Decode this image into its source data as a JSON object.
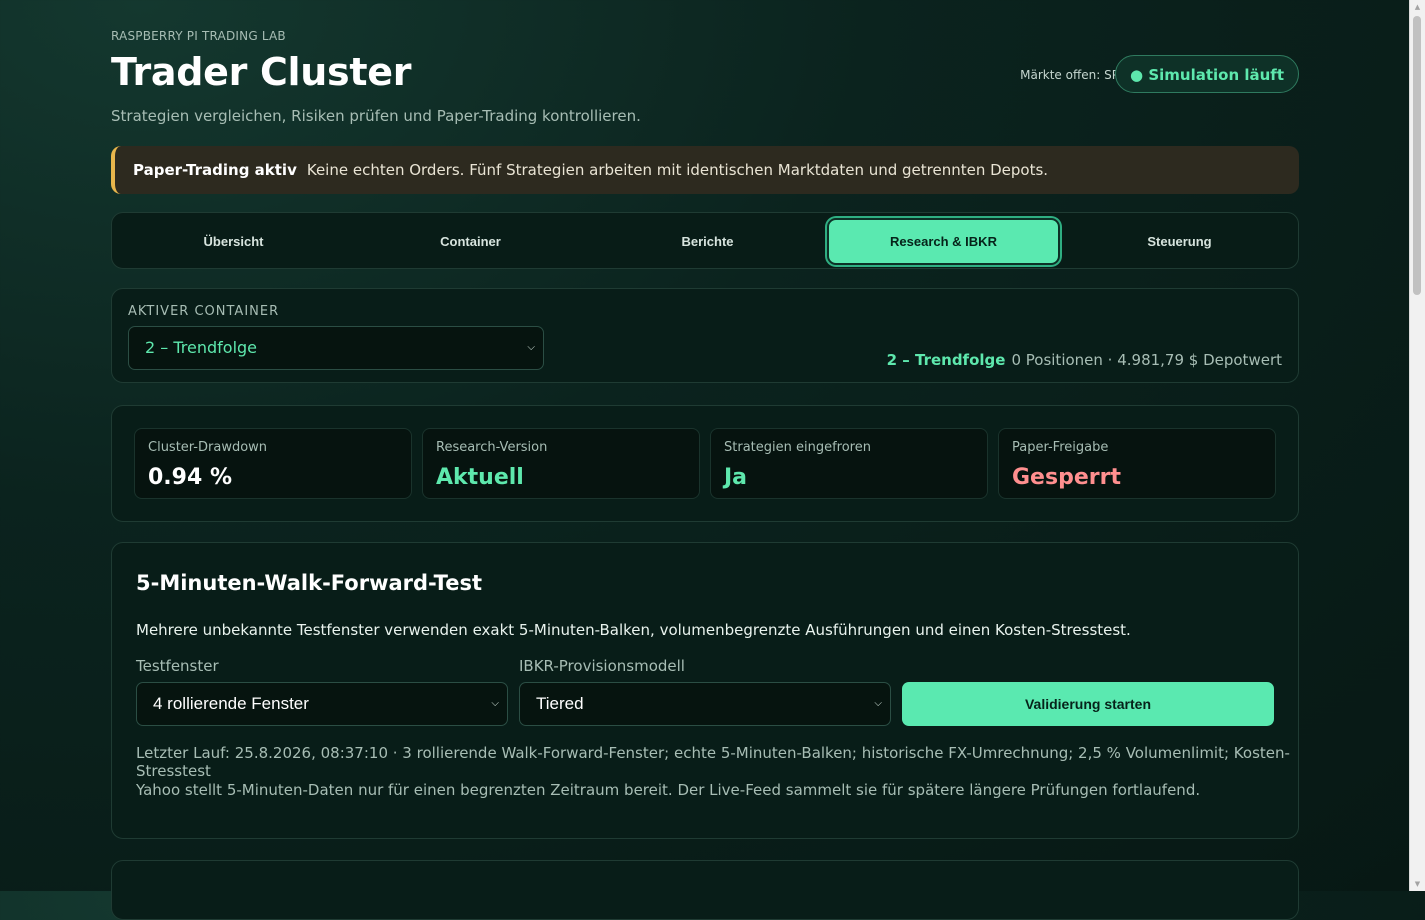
{
  "header": {
    "eyebrow": "RASPBERRY PI TRADING LAB",
    "title": "Trader Cluster",
    "subtitle": "Strategien vergleichen, Risiken prüfen und Paper-Trading kontrollieren.",
    "market_status": "Märkte offen: SPY",
    "simulation_badge": "● Simulation läuft"
  },
  "banner": {
    "label": "Paper-Trading aktiv",
    "text": "Keine echten Orders. Fünf Strategien arbeiten mit identischen Marktdaten und getrennten Depots."
  },
  "tabs": [
    {
      "label": "Übersicht",
      "active": false
    },
    {
      "label": "Container",
      "active": false
    },
    {
      "label": "Berichte",
      "active": false
    },
    {
      "label": "Research & IBKR",
      "active": true
    },
    {
      "label": "Steuerung",
      "active": false
    }
  ],
  "container": {
    "label": "AKTIVER CONTAINER",
    "selected": "2 – Trendfolge",
    "status_name": "2 – Trendfolge",
    "status_text": "0 Positionen · 4.981,79 $ Depotwert"
  },
  "metrics": [
    {
      "label": "Cluster-Drawdown",
      "value": "0.94 %",
      "color": "#ffffff"
    },
    {
      "label": "Research-Version",
      "value": "Aktuell",
      "color": "#5ee8ad"
    },
    {
      "label": "Strategien eingefroren",
      "value": "Ja",
      "color": "#5ee8ad"
    },
    {
      "label": "Paper-Freigabe",
      "value": "Gesperrt",
      "color": "#ff8f8f"
    }
  ],
  "walk_forward": {
    "title": "5-Minuten-Walk-Forward-Test",
    "description": "Mehrere unbekannte Testfenster verwenden exakt 5-Minuten-Balken, volumenbegrenzte Ausführungen und einen Kosten-Stresstest.",
    "window_label": "Testfenster",
    "window_value": "4 rollierende Fenster",
    "commission_label": "IBKR-Provisionsmodell",
    "commission_value": "Tiered",
    "start_button": "Validierung starten",
    "last_run": "Letzter Lauf: 25.8.2026, 08:37:10 · 3 rollierende Walk-Forward-Fenster; echte 5-Minuten-Balken; historische FX-Umrechnung; 2,5 % Volumenlimit; Kosten-Stresstest",
    "note": "Yahoo stellt 5-Minuten-Daten nur für einen begrenzten Zeitraum bereit. Der Live-Feed sammelt sie für spätere längere Prüfungen fortlaufend."
  },
  "colors": {
    "accent": "#5ae9b0",
    "warning": "#e8b64c",
    "danger": "#ff8f8f",
    "background": "#0b231e"
  }
}
